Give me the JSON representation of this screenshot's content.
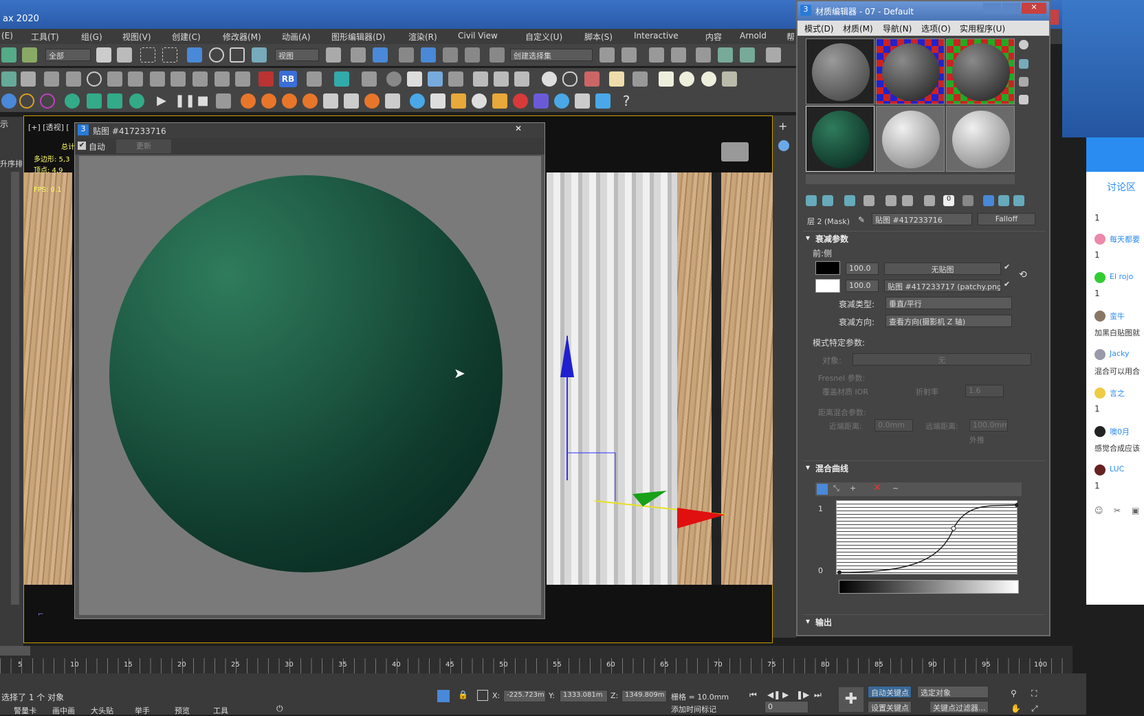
{
  "app": {
    "title": "ax 2020"
  },
  "menu": [
    "(E)",
    "工具(T)",
    "组(G)",
    "视图(V)",
    "创建(C)",
    "修改器(M)",
    "动画(A)",
    "图形编辑器(D)",
    "渲染(R)",
    "Civil View",
    "自定义(U)",
    "脚本(S)",
    "Interactive",
    "内容",
    "Arnold",
    "帮"
  ],
  "toolbar": {
    "select_filter": "全部",
    "view_dropdown": "视图",
    "selection_set": "创建选择集",
    "rb_label": "RB"
  },
  "viewport": {
    "label": "[+] [透视] [",
    "stats_total": "总计",
    "stats_poly": "多边形: 5,3",
    "stats_vert": "顶点:   4,9",
    "fps": "FPS:   0.1",
    "left_tab": "示",
    "left_tab2": "升序排"
  },
  "map_window": {
    "title": "贴图 #417233716",
    "auto_label": "自动",
    "update_label": "更新",
    "close": "✕"
  },
  "mat_editor": {
    "title": "材质编辑器 - 07 - Default",
    "menu": [
      "模式(D)",
      "材质(M)",
      "导航(N)",
      "选项(O)",
      "实用程序(U)"
    ],
    "level_label": "层 2 (Mask)",
    "map_name": "贴图 #417233716",
    "map_type": "Falloff",
    "falloff_params": "衰减参数",
    "front_side": "前:侧",
    "row1_value": "100.0",
    "row1_map": "无贴图",
    "row2_value": "100.0",
    "row2_map": "贴图 #417233717 (patchy.png)",
    "falloff_type_label": "衰减类型:",
    "falloff_type_value": "垂直/平行",
    "falloff_dir_label": "衰减方向:",
    "falloff_dir_value": "查看方向(摄影机 Z 轴)",
    "mode_params": "模式特定参数:",
    "object_label": "对象:",
    "object_value": "无",
    "fresnel_label": "Fresnel 参数:",
    "override_ior": "覆盖材质 IOR",
    "ior_label": "折射率",
    "ior_value": "1.6",
    "dist_blend": "距离混合参数:",
    "near_label": "近端距离:",
    "near_value": "0.0mm",
    "far_label": "远端距离:",
    "far_value": "100.0mm",
    "extrapolate": "外推",
    "mix_curve": "混合曲线",
    "curve_y1": "1",
    "curve_y0": "0",
    "output": "输出"
  },
  "chat": {
    "header": "讨论区",
    "messages": [
      {
        "name": "",
        "text": "1"
      },
      {
        "name": "每天都要",
        "text": "1"
      },
      {
        "name": "El rojo",
        "text": "1"
      },
      {
        "name": "蛮牛",
        "text": "加黑白贴图就"
      },
      {
        "name": "Jacky",
        "text": "混合可以用合"
      },
      {
        "name": "言之",
        "text": "1"
      },
      {
        "name": "噢0月",
        "text": "感觉合成应该"
      },
      {
        "name": "LUC",
        "text": "1"
      }
    ]
  },
  "timeline": {
    "ticks": [
      "5",
      "10",
      "15",
      "20",
      "25",
      "30",
      "35",
      "40",
      "45",
      "50",
      "55",
      "60",
      "65",
      "70",
      "75",
      "80",
      "85",
      "90",
      "95",
      "100"
    ]
  },
  "status": {
    "selected": "选择了 1 个 对象",
    "x": "-225.723m",
    "y": "1333.081m",
    "z": "1349.809m",
    "grid": "栅格 = 10.0mm",
    "auto_key": "自动关键点",
    "selected_obj": "选定对象",
    "set_key": "设置关键点",
    "key_filter": "关键点过滤器...",
    "frame": "0",
    "add_time_tag": "添加时间标记",
    "taskbar": [
      "警量卡",
      "画中画",
      "大头贴",
      "举手",
      "预览",
      "工具"
    ]
  }
}
